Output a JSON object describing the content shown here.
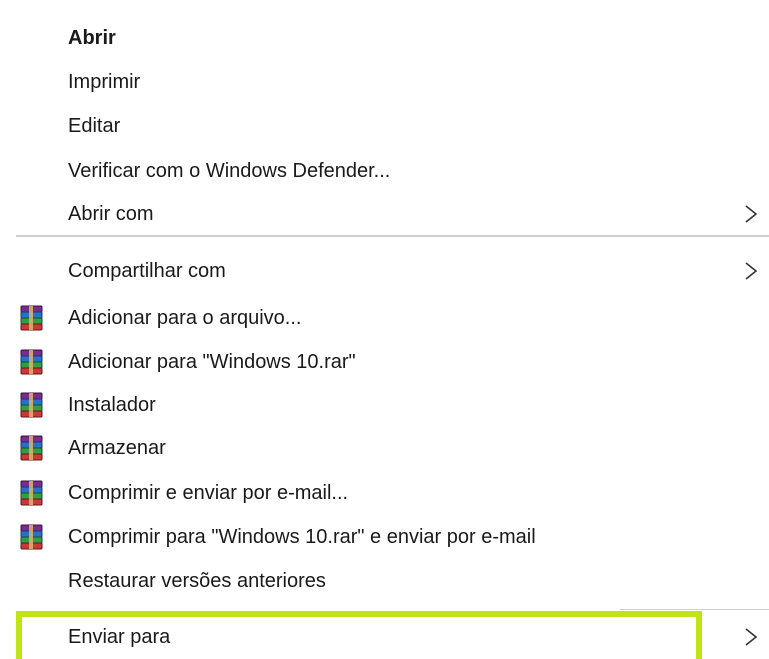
{
  "context_menu": {
    "items": [
      {
        "label": "Abrir"
      },
      {
        "label": "Imprimir"
      },
      {
        "label": "Editar"
      },
      {
        "label": "Verificar com o Windows Defender..."
      },
      {
        "label": "Abrir com"
      },
      {
        "label": "Compartilhar com"
      },
      {
        "label": "Adicionar para o arquivo..."
      },
      {
        "label": "Adicionar para \"Windows 10.rar\""
      },
      {
        "label": "Instalador"
      },
      {
        "label": "Armazenar"
      },
      {
        "label": "Comprimir e enviar por e-mail..."
      },
      {
        "label": "Comprimir para \"Windows 10.rar\" e enviar por e-mail"
      },
      {
        "label": "Restaurar versões anteriores"
      },
      {
        "label": "Enviar para"
      }
    ],
    "highlight_color": "#bfe51a",
    "icons": {
      "submenu": "chevron-right-icon",
      "archive": "winrar-archive-icon"
    }
  }
}
